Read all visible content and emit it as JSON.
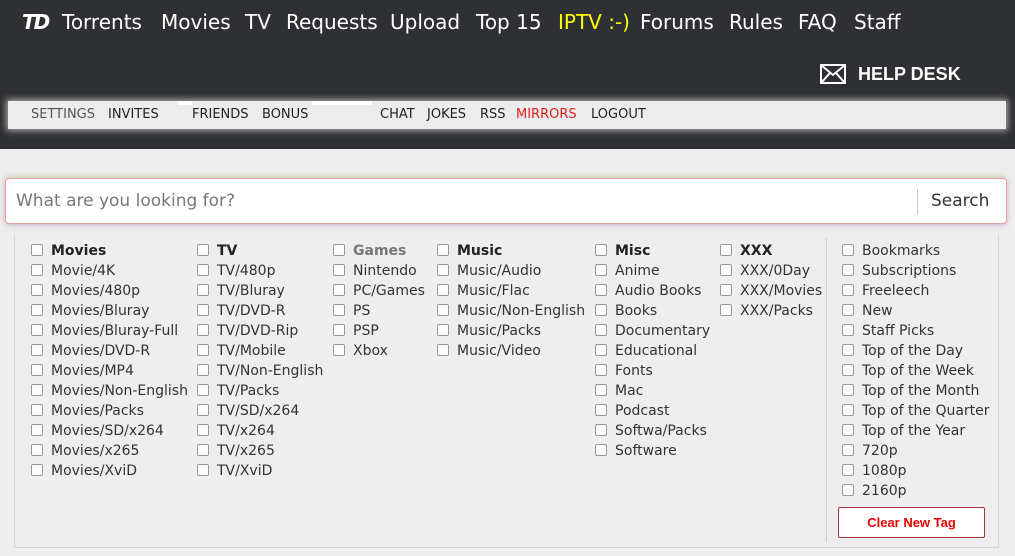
{
  "header": {
    "logo": "TD",
    "nav": [
      "Torrents",
      "Movies",
      "TV",
      "Requests",
      "Upload",
      "Top 15",
      "IPTV :-)",
      "Forums",
      "Rules",
      "FAQ",
      "Staff"
    ],
    "nav_highlight_color": "#ffff00",
    "helpdesk_label": "HELP DESK"
  },
  "subnav": {
    "items": [
      "SETTINGS",
      "INVITES",
      "FRIENDS",
      "BONUS",
      "CHAT",
      "JOKES",
      "RSS",
      "MIRRORS",
      "LOGOUT"
    ],
    "mirrors_color": "#e02020"
  },
  "search": {
    "placeholder": "What are you looking for?",
    "button": "Search"
  },
  "categories": {
    "movies": [
      "Movies",
      "Movie/4K",
      "Movies/480p",
      "Movies/Bluray",
      "Movies/Bluray-Full",
      "Movies/DVD-R",
      "Movies/MP4",
      "Movies/Non-English",
      "Movies/Packs",
      "Movies/SD/x264",
      "Movies/x265",
      "Movies/XviD"
    ],
    "tv": [
      "TV",
      "TV/480p",
      "TV/Bluray",
      "TV/DVD-R",
      "TV/DVD-Rip",
      "TV/Mobile",
      "TV/Non-English",
      "TV/Packs",
      "TV/SD/x264",
      "TV/x264",
      "TV/x265",
      "TV/XviD"
    ],
    "games": [
      "Games",
      "Nintendo",
      "PC/Games",
      "PS",
      "PSP",
      "Xbox"
    ],
    "music": [
      "Music",
      "Music/Audio",
      "Music/Flac",
      "Music/Non-English",
      "Music/Packs",
      "Music/Video"
    ],
    "misc": [
      "Misc",
      "Anime",
      "Audio Books",
      "Books",
      "Documentary",
      "Educational",
      "Fonts",
      "Mac",
      "Podcast",
      "Softwa/Packs",
      "Software"
    ],
    "xxx": [
      "XXX",
      "XXX/0Day",
      "XXX/Movies",
      "XXX/Packs"
    ]
  },
  "tags": {
    "items": [
      "Bookmarks",
      "Subscriptions",
      "Freeleech",
      "New",
      "Staff Picks",
      "Top of the Day",
      "Top of the Week",
      "Top of the Month",
      "Top of the Quarter",
      "Top of the Year",
      "720p",
      "1080p",
      "2160p"
    ],
    "clear_button": "Clear New Tag"
  }
}
